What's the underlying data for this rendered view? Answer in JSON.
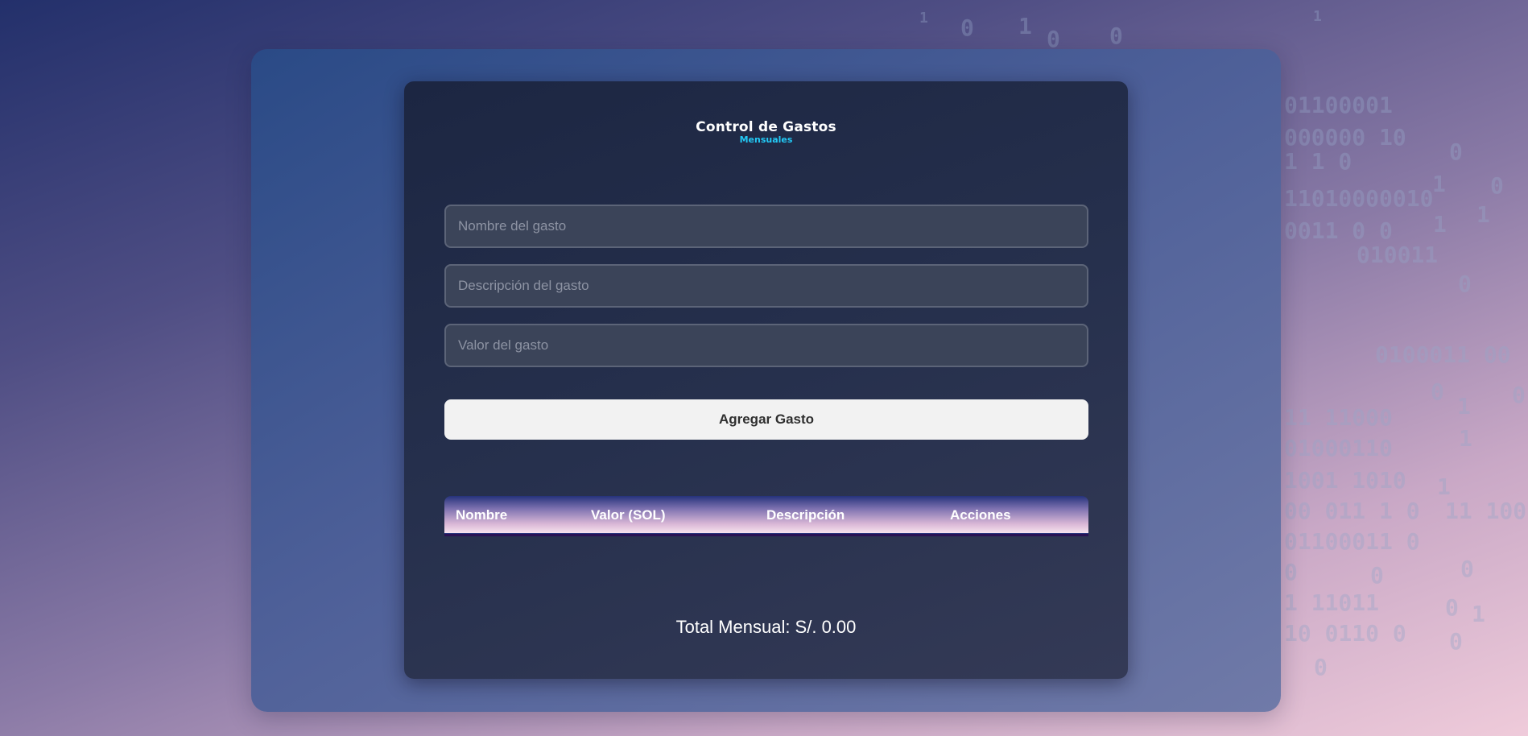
{
  "app": {
    "title": "Control de Gastos",
    "subtitle": "Mensuales"
  },
  "form": {
    "name_placeholder": "Nombre del gasto",
    "description_placeholder": "Descripción del gasto",
    "value_placeholder": "Valor del gasto",
    "name_value": "",
    "description_value": "",
    "value_value": "",
    "submit_label": "Agregar Gasto"
  },
  "table": {
    "headers": [
      "Nombre",
      "Valor (SOL)",
      "Descripción",
      "Acciones"
    ],
    "rows": []
  },
  "summary": {
    "total_label": "Total Mensual: S/. 0.00"
  },
  "background": {
    "binary_lines": [
      "1",
      "0",
      "1",
      "0",
      "0",
      "1",
      "01100001",
      "000000 10",
      "1 1 0",
      "0",
      "1",
      "0",
      "11010000010",
      "0011 0 0",
      "1",
      "1",
      "010011",
      "0",
      "0100011 00",
      "0",
      "1",
      "0",
      "11 11000",
      "1",
      "01000110",
      "1001 1010",
      "1",
      "00 011 1 0",
      "11 100",
      "01100011 0",
      "0",
      "0",
      "0",
      "1 11011",
      "0",
      "1",
      "10 0110 0",
      "0",
      "0"
    ]
  },
  "colors": {
    "accent": "#22c9f5",
    "card_background": "#1f2944",
    "button_background": "#f2f2f2"
  }
}
